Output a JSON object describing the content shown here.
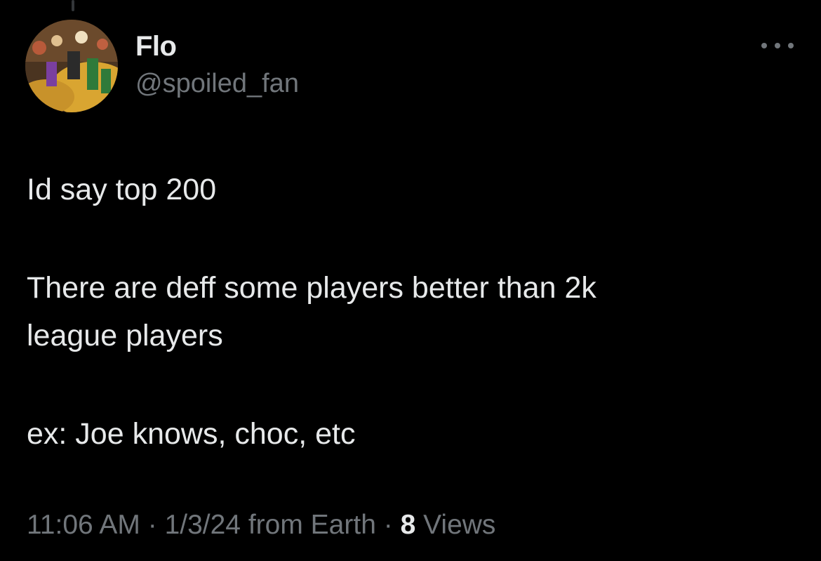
{
  "user": {
    "display_name": "Flo",
    "handle": "@spoiled_fan"
  },
  "tweet": {
    "line1": "Id say top 200",
    "line2": "There are deff some players better than 2k",
    "line3": "league players",
    "line4": "ex:  Joe knows, choc, etc"
  },
  "meta": {
    "time": "11:06 AM",
    "separator1": " · ",
    "date": "1/3/24",
    "source": " from Earth",
    "separator2": " · ",
    "views_count": "8",
    "views_label": " Views"
  },
  "icons": {
    "more": "more-horizontal-icon",
    "avatar": "profile-avatar"
  },
  "colors": {
    "background": "#000000",
    "primary_text": "#e7e9ea",
    "secondary_text": "#71767b"
  }
}
